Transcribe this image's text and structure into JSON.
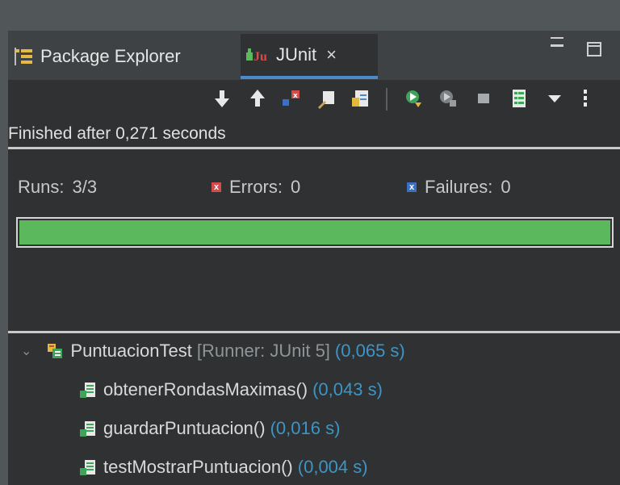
{
  "tabs": {
    "package_explorer": "Package Explorer",
    "junit": "JUnit",
    "close_glyph": "×"
  },
  "status": {
    "finished": "Finished after 0,271 seconds"
  },
  "stats": {
    "runs_label": "Runs:",
    "runs_value": "3/3",
    "errors_label": "Errors:",
    "errors_value": "0",
    "failures_label": "Failures:",
    "failures_value": "0",
    "progress_fraction": 1.0
  },
  "tree": {
    "suite": {
      "name": "PuntuacionTest",
      "runner": "[Runner: JUnit 5]",
      "time": "(0,065 s)"
    },
    "cases": [
      {
        "name": "obtenerRondasMaximas()",
        "time": "(0,043 s)"
      },
      {
        "name": "guardarPuntuacion()",
        "time": "(0,016 s)"
      },
      {
        "name": "testMostrarPuntuacion()",
        "time": "(0,004 s)"
      }
    ]
  },
  "colors": {
    "success": "#5cb85c",
    "time": "#3d95c6",
    "accent": "#4a8ac6"
  },
  "icons": {
    "toolbar": [
      "next-failure-icon",
      "previous-failure-icon",
      "show-failures-only-icon",
      "scroll-lock-icon",
      "show-skipped-icon",
      "rerun-icon",
      "rerun-failed-first-icon",
      "stop-icon",
      "history-icon",
      "view-menu-icon",
      "more-icon"
    ]
  }
}
